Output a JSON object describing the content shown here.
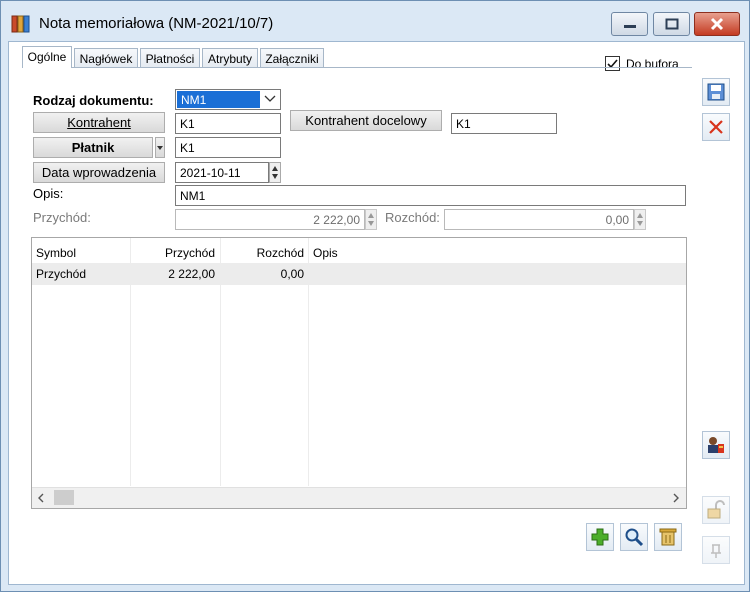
{
  "window": {
    "title": "Nota memoriałowa (NM-2021/10/7)",
    "icons": {
      "app": "binders-icon",
      "minimize": "minimize-icon",
      "maximize": "maximize-icon",
      "close": "close-icon"
    }
  },
  "tabs": [
    {
      "label": "Ogólne",
      "active": true
    },
    {
      "label": "Nagłówek",
      "active": false
    },
    {
      "label": "Płatności",
      "active": false
    },
    {
      "label": "Atrybuty",
      "active": false
    },
    {
      "label": "Załączniki",
      "active": false
    }
  ],
  "do_bufora": {
    "label": "Do bufora",
    "checked": true
  },
  "form": {
    "rodzaj_label": "Rodzaj dokumentu:",
    "rodzaj_value": "NM1",
    "kontrahent_button": "Kontrahent",
    "kontrahent_value": "K1",
    "kontrahent_docelowy_button": "Kontrahent docelowy",
    "kontrahent_docelowy_value": "K1",
    "platnik_button": "Płatnik",
    "platnik_value": "K1",
    "data_button": "Data wprowadzenia",
    "data_value": "2021-10-11",
    "opis_label": "Opis:",
    "opis_value": "NM1",
    "przychod_label": "Przychód:",
    "przychod_value": "2 222,00",
    "rozchod_label": "Rozchód:",
    "rozchod_value": "0,00"
  },
  "grid": {
    "columns": [
      "Symbol",
      "Przychód",
      "Rozchód",
      "Opis"
    ],
    "rows": [
      {
        "symbol": "Przychód",
        "przychod": "2 222,00",
        "rozchod": "0,00",
        "opis": ""
      }
    ]
  },
  "colors": {
    "accent": "#1a6fd6",
    "window_frame": "#dbe8f5",
    "close_red": "#c43b22"
  },
  "sidebar_icons": [
    "save-icon",
    "delete-icon",
    "contractor-icon",
    "unlock-icon",
    "pin-icon"
  ],
  "toolbar_icons": [
    "add-icon",
    "search-icon",
    "trash-icon"
  ]
}
